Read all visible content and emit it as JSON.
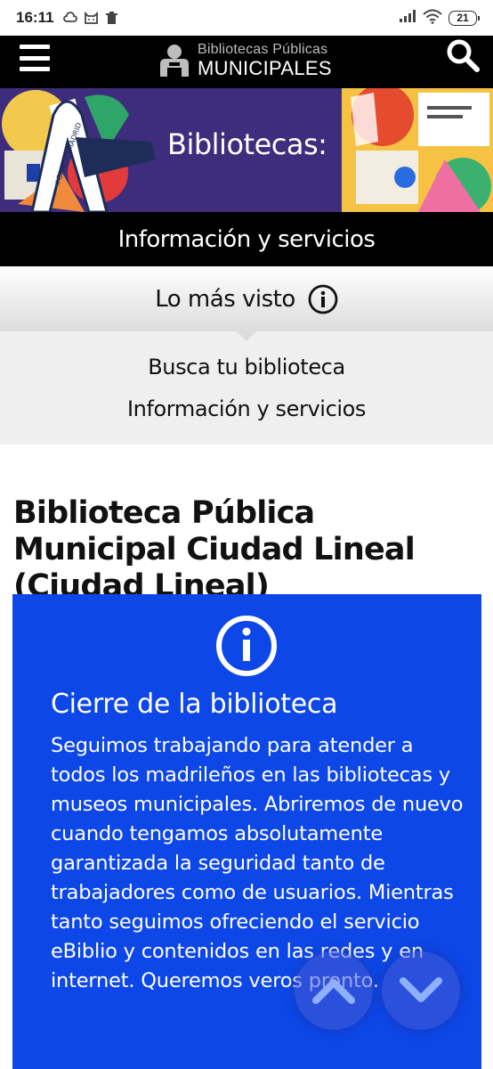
{
  "status_bar": {
    "time": "16:11",
    "battery": "21",
    "icons": [
      "weather-icon",
      "cat-icon",
      "trash-icon",
      "signal-icon",
      "wifi-icon",
      "battery-icon"
    ]
  },
  "header": {
    "logo_line1": "Bibliotecas Públicas",
    "logo_line2": "MUNICIPALES",
    "icons": [
      "menu-icon",
      "logo-icon",
      "search-icon"
    ]
  },
  "banner": {
    "title": "Bibliotecas:",
    "ribbon_text": "#GRACIASMADRID"
  },
  "subheader": {
    "title": "Información y servicios"
  },
  "most_viewed": {
    "label": "Lo más visto",
    "items": [
      "Busca tu biblioteca",
      "Información y servicios"
    ]
  },
  "page": {
    "title": "Biblioteca Pública Municipal Ciudad Lineal (Ciudad Lineal)"
  },
  "notice": {
    "title": "Cierre de la biblioteca",
    "body": "Seguimos trabajando para atender a todos los madrileños en las bibliotecas y museos municipales. Abriremos de nuevo cuando tengamos absolutamente garantizada la seguridad tanto de trabajadores como de usuarios. Mientras tanto seguimos ofreciendo el servicio eBiblio y contenidos en las redes y en internet. Queremos veros pronto.",
    "colors": {
      "background": "#0d47e8",
      "text": "#ffffff"
    }
  },
  "floating_nav": {
    "icons": [
      "chevron-up-icon",
      "chevron-down-icon"
    ]
  }
}
